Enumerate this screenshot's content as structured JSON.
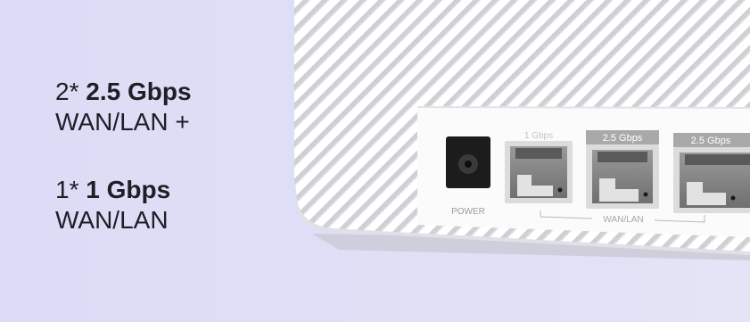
{
  "specs": [
    {
      "prefix": "2* ",
      "speed": "2.5 Gbps",
      "type": "WAN/LAN +"
    },
    {
      "prefix": "1*  ",
      "speed": "1 Gbps",
      "type": "WAN/LAN"
    }
  ],
  "device": {
    "power_label": "POWER",
    "ports": [
      "1 Gbps",
      "2.5 Gbps",
      "2.5 Gbps"
    ],
    "group_label": "WAN/LAN"
  },
  "colors": {
    "background": "#dedef6",
    "text": "#1e1e26",
    "device_body": "#fbfbfb",
    "port_label_bg": "#a9a9a9"
  }
}
